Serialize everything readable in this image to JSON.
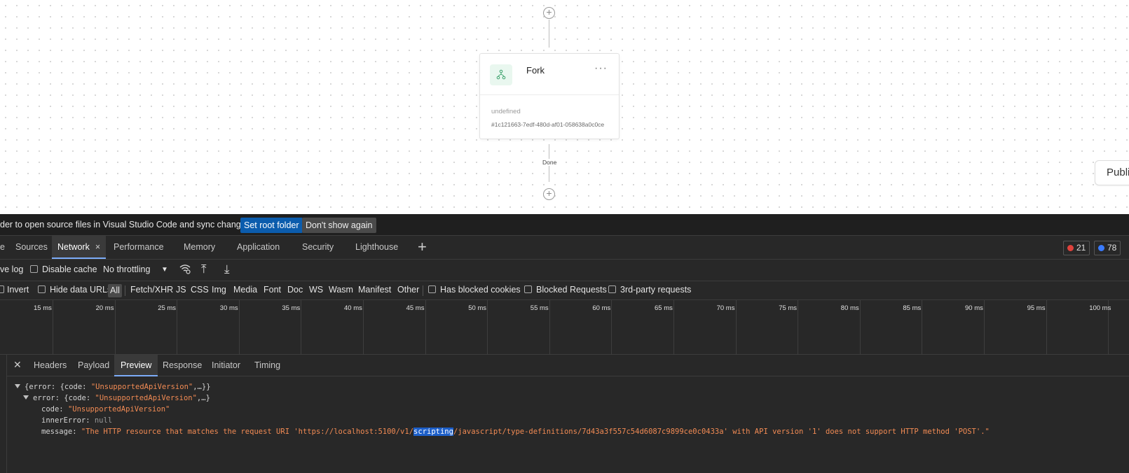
{
  "canvas": {
    "node": {
      "title": "Fork",
      "more": "···",
      "subtitle": "undefined",
      "id_text": "#1c121663-7edf-480d-af01-058638a0c0ce"
    },
    "connector_label": "Done",
    "publish_label": "Publi"
  },
  "devtools": {
    "infobar": {
      "message": "der to open source files in Visual Studio Code and sync changes.",
      "set_root": "Set root folder",
      "dont_show": "Don't show again"
    },
    "tabs": [
      "e",
      "Sources",
      "Network",
      "Performance",
      "Memory",
      "Application",
      "Security",
      "Lighthouse"
    ],
    "active_tab_close": "×",
    "plus": "+",
    "errors_count": "21",
    "messages_count": "78",
    "colors": {
      "error": "#e0423c",
      "info": "#3a7bff",
      "accent": "#7cacf8"
    },
    "toolbar": {
      "preserve_log": "ve log",
      "disable_cache": "Disable cache",
      "throttling": "No throttling",
      "dropdown_icon": "▼",
      "wifi_icon": "network-conditions-icon",
      "upload_icon": "⤒",
      "download_icon": "⤓"
    },
    "filters": {
      "invert": "Invert",
      "hide_data_urls": "Hide data URLs",
      "types": [
        "All",
        "Fetch/XHR",
        "JS",
        "CSS",
        "Img",
        "Media",
        "Font",
        "Doc",
        "WS",
        "Wasm",
        "Manifest",
        "Other"
      ],
      "has_blocked_cookies": "Has blocked cookies",
      "blocked_requests": "Blocked Requests",
      "third_party": "3rd-party requests"
    },
    "timeline_ticks": [
      "15 ms",
      "20 ms",
      "25 ms",
      "30 ms",
      "35 ms",
      "40 ms",
      "45 ms",
      "50 ms",
      "55 ms",
      "60 ms",
      "65 ms",
      "70 ms",
      "75 ms",
      "80 ms",
      "85 ms",
      "90 ms",
      "95 ms",
      "100 ms"
    ],
    "detail_tabs": [
      "Headers",
      "Payload",
      "Preview",
      "Response",
      "Initiator",
      "Timing"
    ],
    "close_icon": "✕",
    "preview": {
      "line1_key": "{error: {code: ",
      "line1_str": "\"UnsupportedApiVersion\"",
      "line1_tail": ",…}}",
      "line2_key": "error: {code: ",
      "line2_str": "\"UnsupportedApiVersion\"",
      "line2_tail": ",…}",
      "code_key": "code: ",
      "code_val": "\"UnsupportedApiVersion\"",
      "inner_key": "innerError: ",
      "inner_val": "null",
      "message_key": "message: ",
      "message_pre": "\"The HTTP resource that matches the request URI 'https://localhost:5100/v1/",
      "message_hl": "scripting",
      "message_post": "/javascript/type-definitions/7d43a3f557c54d6087c9899ce0c0433a' with API version '1' does not support HTTP method 'POST'.\""
    }
  }
}
